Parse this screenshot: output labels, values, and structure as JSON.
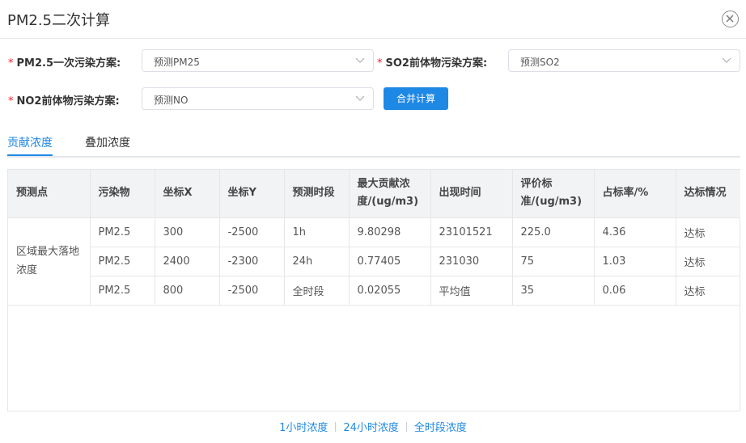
{
  "dialog": {
    "title": "PM2.5二次计算"
  },
  "form": {
    "primary": {
      "label": "PM2.5一次污染方案:",
      "value": "预测PM25"
    },
    "so2": {
      "label": "SO2前体物污染方案:",
      "value": "预测SO2"
    },
    "no2": {
      "label": "NO2前体物污染方案:",
      "value": "预测NO"
    },
    "required_mark": "*",
    "merge_button": "合并计算"
  },
  "tabs": [
    {
      "label": "贡献浓度",
      "active": true
    },
    {
      "label": "叠加浓度",
      "active": false
    }
  ],
  "table": {
    "headers": [
      "预测点",
      "污染物",
      "坐标X",
      "坐标Y",
      "预测时段",
      "最大贡献浓度/(ug/m3)",
      "出现时间",
      "评价标准/(ug/m3)",
      "占标率/%",
      "达标情况"
    ],
    "point": "区域最大落地浓度",
    "rows": [
      [
        "PM2.5",
        "300",
        "-2500",
        "1h",
        "9.80298",
        "23101521",
        "225.0",
        "4.36",
        "达标"
      ],
      [
        "PM2.5",
        "2400",
        "-2300",
        "24h",
        "0.77405",
        "231030",
        "75",
        "1.03",
        "达标"
      ],
      [
        "PM2.5",
        "800",
        "-2500",
        "全时段",
        "0.02055",
        "平均值",
        "35",
        "0.06",
        "达标"
      ]
    ]
  },
  "footer_links": [
    "1小时浓度",
    "24小时浓度",
    "全时段浓度"
  ],
  "colors": {
    "accent": "#1e88e5",
    "required": "#f5222d",
    "header_bg": "#f2f3f5"
  }
}
